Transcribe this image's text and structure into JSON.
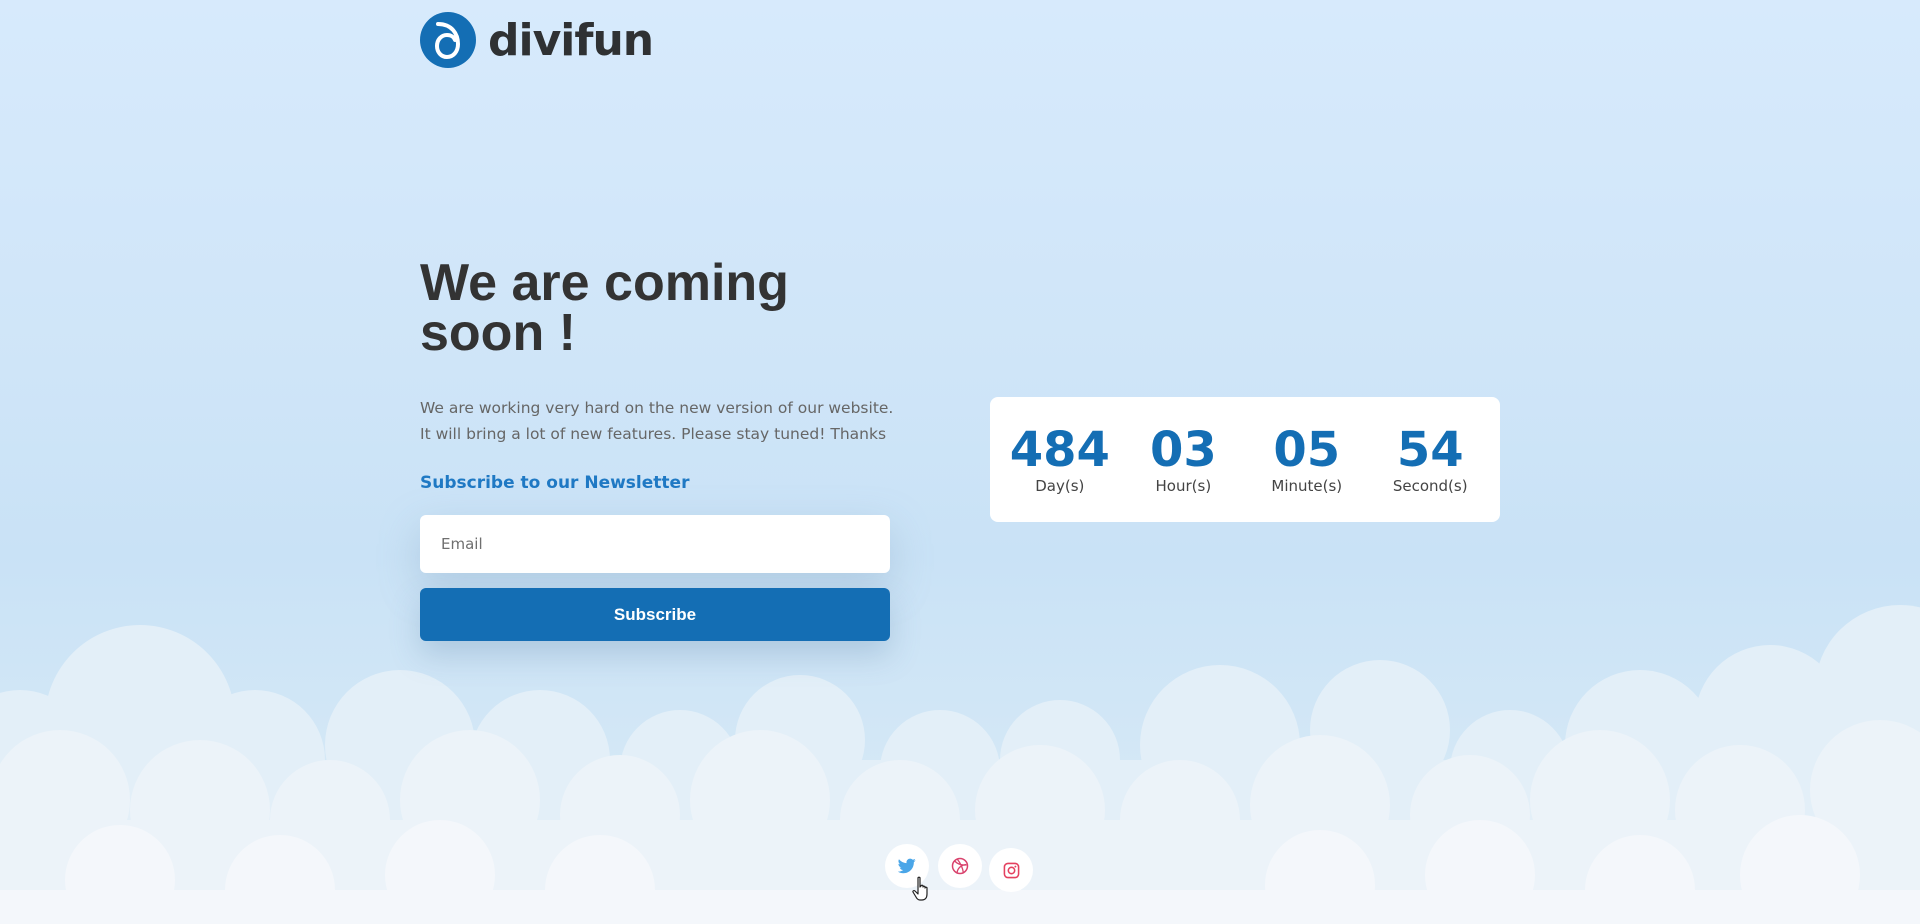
{
  "brand": {
    "name": "divifun",
    "logo_icon": "divifun-logo-icon"
  },
  "hero": {
    "headline": "We are coming soon !",
    "description": "We are working very hard on the new version of our website. It will bring a  lot of new features. Please stay tuned! Thanks"
  },
  "newsletter": {
    "title": "Subscribe to our Newsletter",
    "email_placeholder": "Email",
    "email_value": "",
    "button_label": "Subscribe"
  },
  "countdown": [
    {
      "value": "484",
      "label": "Day(s)"
    },
    {
      "value": "03",
      "label": "Hour(s)"
    },
    {
      "value": "05",
      "label": "Minute(s)"
    },
    {
      "value": "54",
      "label": "Second(s)"
    }
  ],
  "social": [
    {
      "icon": "twitter-icon",
      "color": "#4aa6e8"
    },
    {
      "icon": "dribbble-icon",
      "color": "#d9436d"
    },
    {
      "icon": "instagram-icon",
      "color": "#e4405f"
    }
  ],
  "colors": {
    "accent": "#146eb4",
    "heading": "#333333",
    "background": "#d7eafc"
  }
}
